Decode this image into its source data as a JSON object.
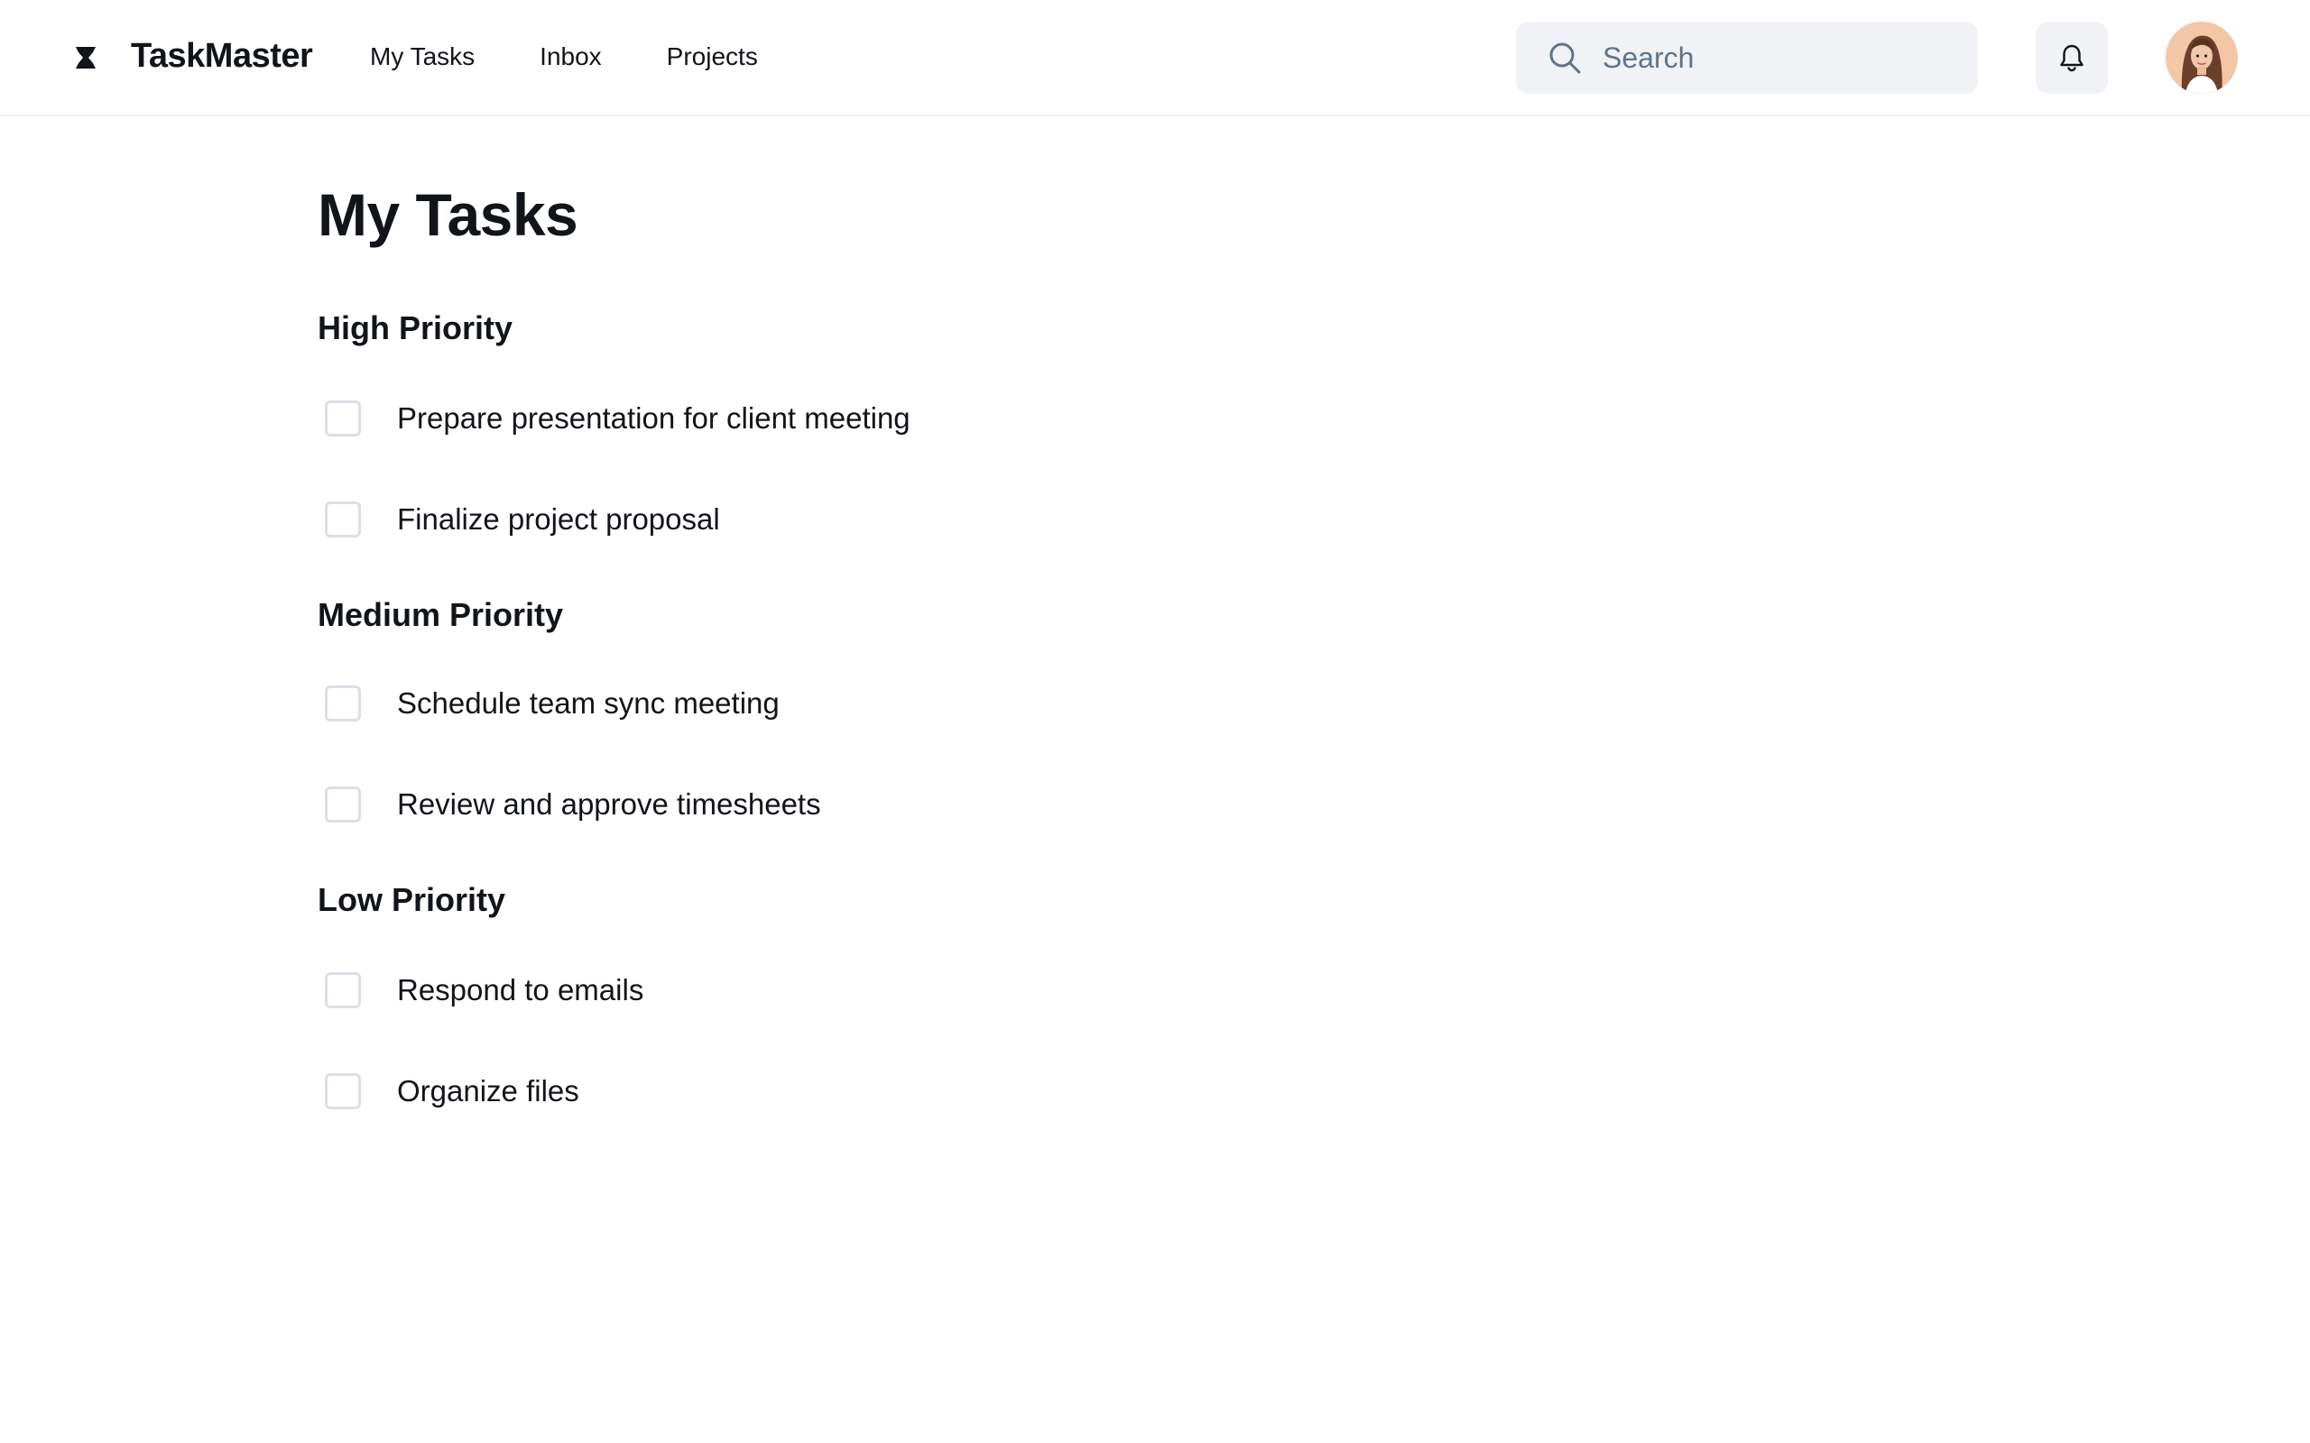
{
  "header": {
    "brand": "TaskMaster",
    "logo_icon": "hourglass-logo-icon",
    "nav": [
      {
        "label": "My Tasks"
      },
      {
        "label": "Inbox"
      },
      {
        "label": "Projects"
      }
    ],
    "search": {
      "placeholder": "Search",
      "value": "",
      "icon": "search-icon"
    },
    "notifications_icon": "bell-icon",
    "avatar_icon": "user-avatar"
  },
  "main": {
    "title": "My Tasks",
    "sections": [
      {
        "heading": "High Priority",
        "tasks": [
          {
            "label": "Prepare presentation for client meeting",
            "done": false
          },
          {
            "label": "Finalize project proposal",
            "done": false
          }
        ]
      },
      {
        "heading": "Medium Priority",
        "tasks": [
          {
            "label": "Schedule team sync meeting",
            "done": false
          },
          {
            "label": "Review and approve timesheets",
            "done": false
          }
        ]
      },
      {
        "heading": "Low Priority",
        "tasks": [
          {
            "label": "Respond to emails",
            "done": false
          },
          {
            "label": "Organize files",
            "done": false
          }
        ]
      }
    ]
  },
  "colors": {
    "text": "#111418",
    "search_bg": "#f0f2f5",
    "placeholder": "#60748a",
    "checkbox_border": "#dbe0e6",
    "divider": "#eef0f3"
  }
}
